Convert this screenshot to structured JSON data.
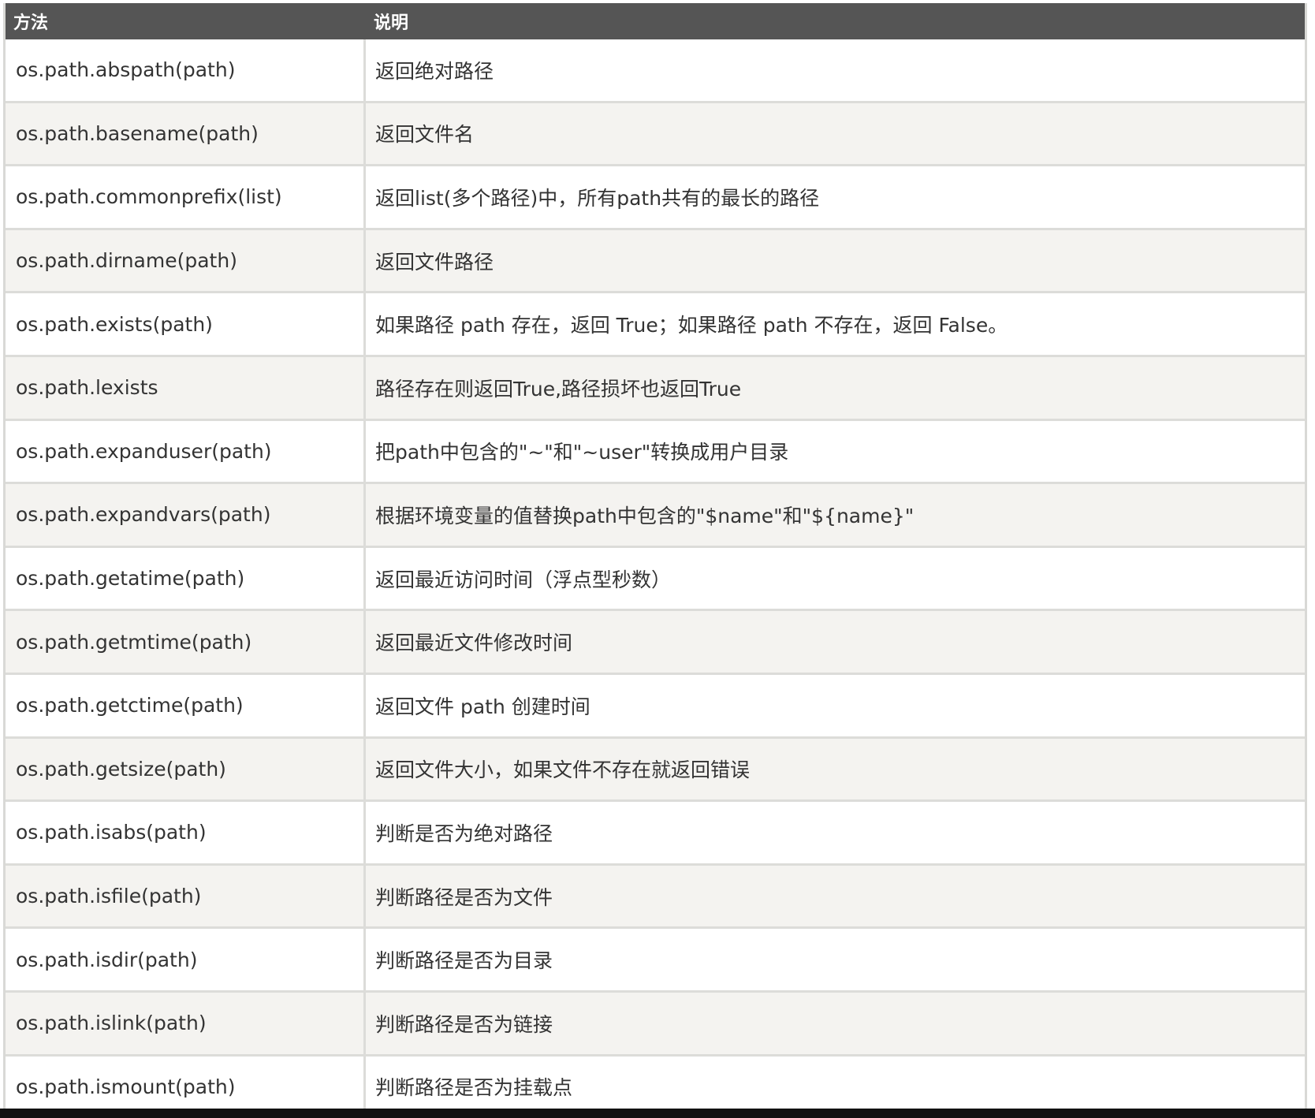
{
  "table": {
    "headers": {
      "method": "方法",
      "description": "说明"
    },
    "rows": [
      {
        "method": "os.path.abspath(path)",
        "description": "返回绝对路径"
      },
      {
        "method": "os.path.basename(path)",
        "description": "返回文件名"
      },
      {
        "method": "os.path.commonprefix(list)",
        "description": "返回list(多个路径)中，所有path共有的最长的路径"
      },
      {
        "method": "os.path.dirname(path)",
        "description": "返回文件路径"
      },
      {
        "method": "os.path.exists(path)",
        "description": "如果路径 path 存在，返回 True；如果路径 path 不存在，返回 False。"
      },
      {
        "method": "os.path.lexists",
        "description": "路径存在则返回True,路径损坏也返回True"
      },
      {
        "method": "os.path.expanduser(path)",
        "description": "把path中包含的\"~\"和\"~user\"转换成用户目录"
      },
      {
        "method": "os.path.expandvars(path)",
        "description": "根据环境变量的值替换path中包含的\"$name\"和\"${name}\""
      },
      {
        "method": "os.path.getatime(path)",
        "description": "返回最近访问时间（浮点型秒数）"
      },
      {
        "method": "os.path.getmtime(path)",
        "description": "返回最近文件修改时间"
      },
      {
        "method": "os.path.getctime(path)",
        "description": "返回文件 path 创建时间"
      },
      {
        "method": "os.path.getsize(path)",
        "description": "返回文件大小，如果文件不存在就返回错误"
      },
      {
        "method": "os.path.isabs(path)",
        "description": "判断是否为绝对路径"
      },
      {
        "method": "os.path.isfile(path)",
        "description": "判断路径是否为文件"
      },
      {
        "method": "os.path.isdir(path)",
        "description": "判断路径是否为目录"
      },
      {
        "method": "os.path.islink(path)",
        "description": "判断路径是否为链接"
      },
      {
        "method": "os.path.ismount(path)",
        "description": "判断路径是否为挂载点"
      }
    ]
  }
}
